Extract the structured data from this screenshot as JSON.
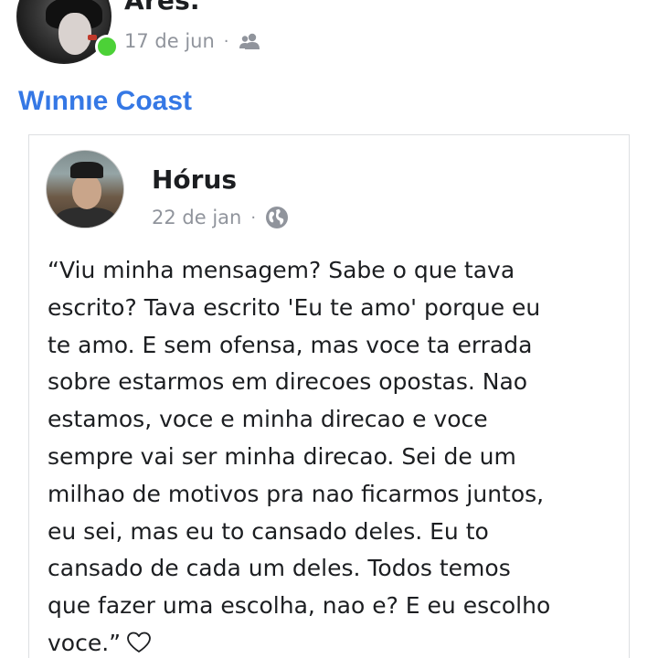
{
  "post": {
    "author": "Ares.",
    "date": "17 de jun",
    "separator": "·",
    "audience_icon": "friends-icon",
    "online_status_color": "#4cd137",
    "more_icon": "more-dots-icon"
  },
  "group": {
    "name": "Wınnıe Coast",
    "color": "#3578e5"
  },
  "shared_post": {
    "author": "Hórus",
    "date": "22 de jan",
    "separator": "·",
    "audience_icon": "globe-icon",
    "text_lines": [
      "“Viu minha mensagem? Sabe o que tava",
      "escrito? Tava escrito 'Eu te amo' porque eu",
      "te amo. E sem ofensa, mas voce ta errada",
      "sobre estarmos em direcoes opostas. Nao",
      "estamos, voce e minha direcao e voce",
      "sempre vai ser minha direcao. Sei de um",
      "milhao de motivos pra nao ficarmos juntos,",
      "eu sei, mas eu to cansado deles. Eu to",
      "cansado de cada um deles. Todos temos",
      "que fazer uma escolha, nao e? E eu escolho",
      "voce.”"
    ],
    "trailing_icon": "heart-icon"
  },
  "colors": {
    "text": "#1c1e21",
    "meta": "#90949c",
    "border": "#dddfe2"
  }
}
